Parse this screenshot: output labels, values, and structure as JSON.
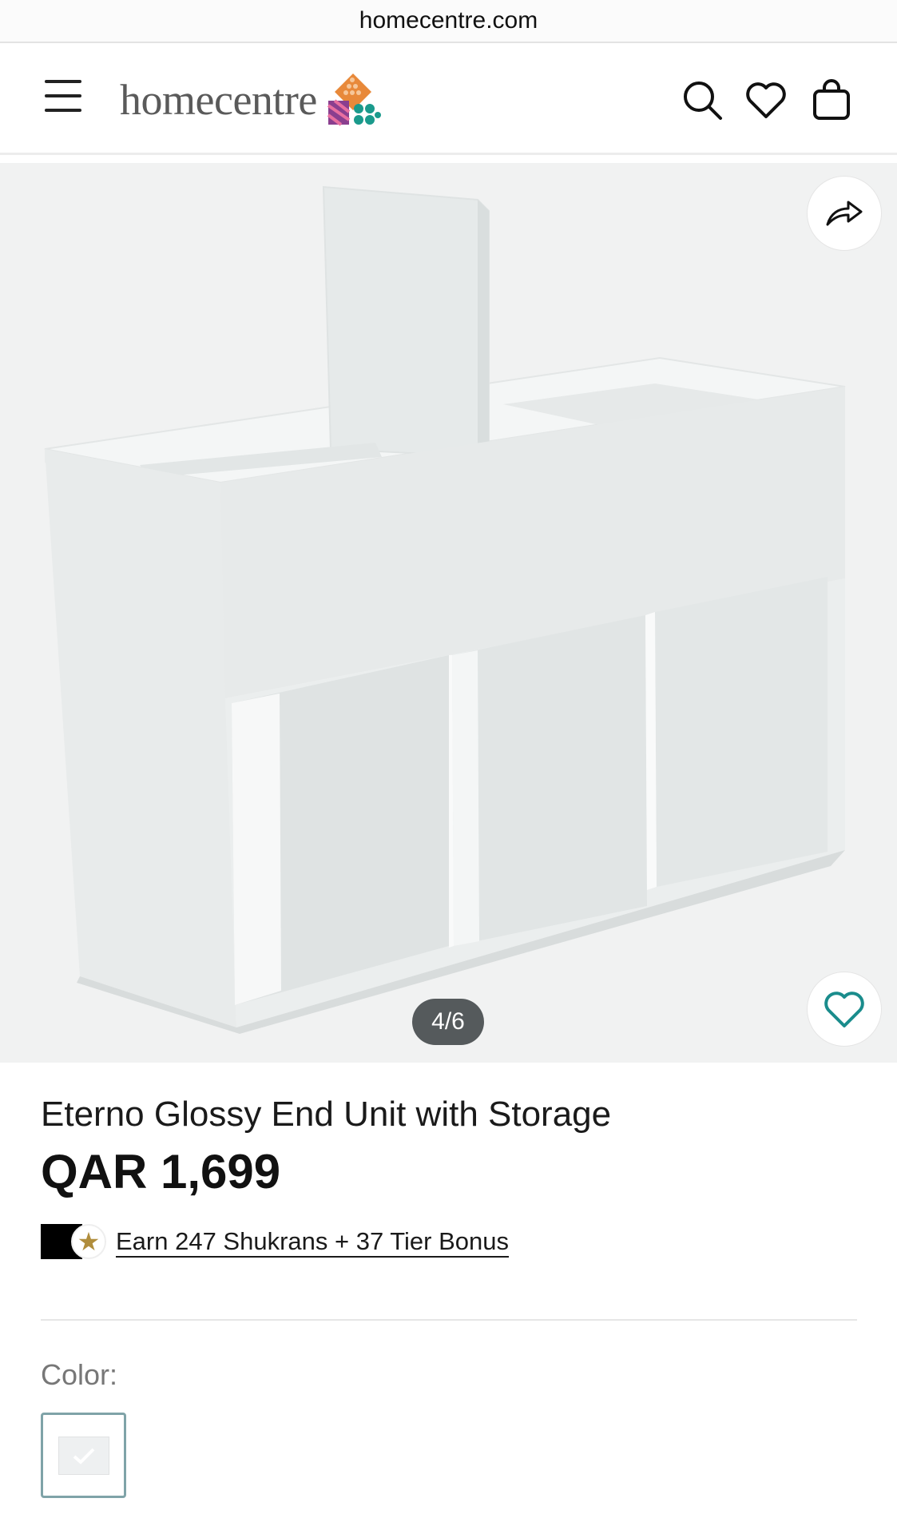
{
  "browser": {
    "url": "homecentre.com"
  },
  "header": {
    "logo_text": "homecentre",
    "icons": [
      "menu-icon",
      "search-icon",
      "heart-icon",
      "bag-icon"
    ]
  },
  "gallery": {
    "counter": "4/6",
    "icons": [
      "share-icon",
      "heart-icon"
    ],
    "accent_color": "#1a8c8c"
  },
  "product": {
    "title": "Eterno Glossy End Unit with Storage",
    "price": "QAR 1,699",
    "shukran_text": "Earn 247 Shukrans + 37  Tier Bonus",
    "color_label": "Color:"
  },
  "colors": {
    "brand_gold": "#b08d3c",
    "swatch_border": "#7fa3a8"
  }
}
